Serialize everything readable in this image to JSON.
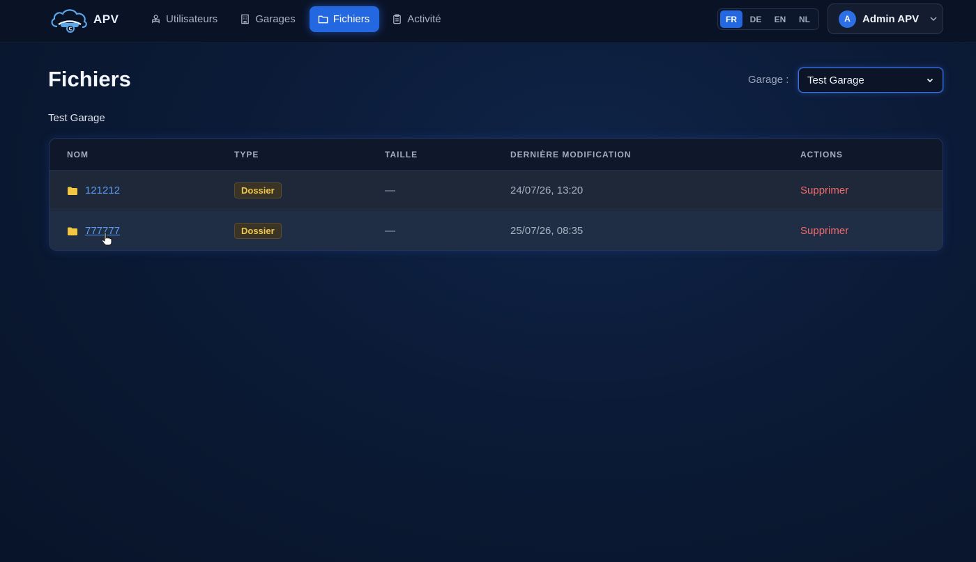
{
  "app": {
    "logo_text": "APV"
  },
  "nav": {
    "items": [
      {
        "label": "Utilisateurs",
        "icon": "users-icon"
      },
      {
        "label": "Garages",
        "icon": "building-icon"
      },
      {
        "label": "Fichiers",
        "icon": "folder-icon",
        "active": true
      },
      {
        "label": "Activité",
        "icon": "clipboard-icon"
      }
    ]
  },
  "languages": {
    "items": [
      "FR",
      "DE",
      "EN",
      "NL"
    ],
    "selected": "FR"
  },
  "user": {
    "initial": "A",
    "name": "Admin APV"
  },
  "page": {
    "title": "Fichiers",
    "garage_label": "Garage :",
    "garage_selected": "Test Garage",
    "subtitle": "Test Garage"
  },
  "table": {
    "headers": [
      "NOM",
      "TYPE",
      "TAILLE",
      "DERNIÈRE MODIFICATION",
      "ACTIONS"
    ],
    "rows": [
      {
        "name": "121212",
        "type": "Dossier",
        "size": "—",
        "modified": "24/07/26, 13:20",
        "action": "Supprimer"
      },
      {
        "name": "777777",
        "type": "Dossier",
        "size": "—",
        "modified": "25/07/26, 08:35",
        "action": "Supprimer"
      }
    ]
  },
  "colors": {
    "accent": "#2368e0",
    "link": "#5b9cf0",
    "danger": "#ef6a6a",
    "badge_text": "#f1c74a",
    "folder": "#f2c640"
  }
}
